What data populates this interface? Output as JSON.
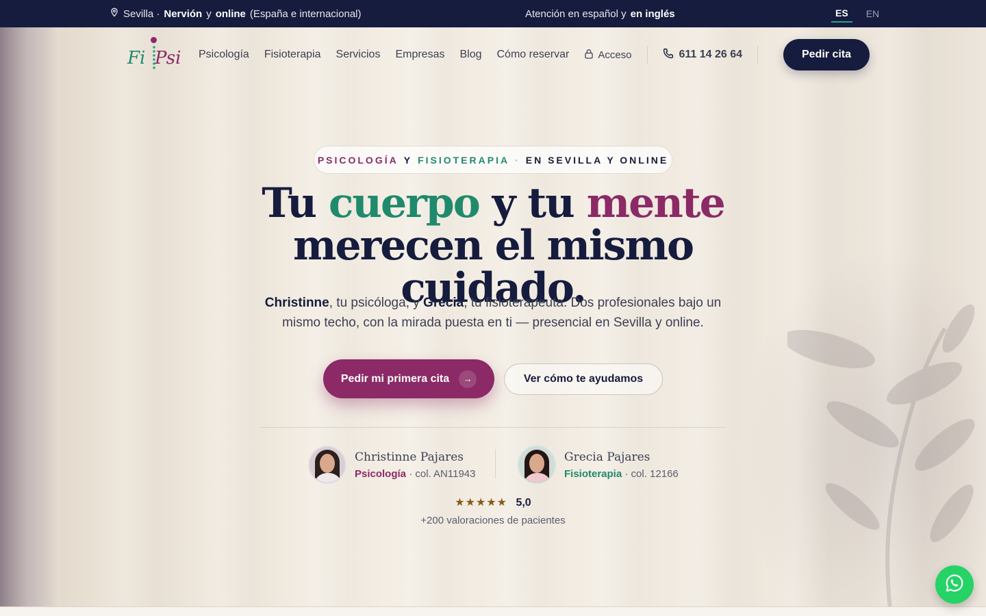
{
  "topbar": {
    "location_city": "Sevilla ·",
    "location_area": "Nervión",
    "location_y": "y",
    "location_online": "online",
    "location_scope": "(España e internacional)",
    "attention": "Atención en español y",
    "attention_english": "en inglés",
    "languages": [
      {
        "code": "ES",
        "active": true
      },
      {
        "code": "EN",
        "active": false
      }
    ]
  },
  "logo": {
    "fi": "Fi",
    "psi": "Psi"
  },
  "nav": {
    "items": [
      "Psicología",
      "Fisioterapia",
      "Servicios",
      "Empresas",
      "Blog",
      "Cómo reservar"
    ],
    "access": "Acceso",
    "phone": "611 14 26 64",
    "cta": "Pedir cita"
  },
  "hero": {
    "pill": {
      "psicologia": "PSICOLOGÍA",
      "y": "Y",
      "fisioterapia": "FISIOTERAPIA",
      "dot": "·",
      "location": "EN SEVILLA Y ONLINE"
    },
    "headline": {
      "tu1": "Tu",
      "cuerpo": "cuerpo",
      "ytu": "y tu",
      "mente": "mente",
      "line2": "merecen el mismo cuidado."
    },
    "lead": {
      "name1": "Christinne",
      "text1": ", tu psicóloga, y",
      "name2": "Grecia",
      "text2": ", tu fisioterapeuta. Dos profesionales bajo un mismo techo, con la mirada puesta en ti — presencial en Sevilla y online."
    },
    "cta_primary": "Pedir mi primera cita",
    "cta_primary_arrow": "→",
    "cta_secondary": "Ver cómo te ayudamos"
  },
  "people": [
    {
      "name": "Christinne Pajares",
      "role": "Psicología",
      "college": "· col. AN11943"
    },
    {
      "name": "Grecia Pajares",
      "role": "Fisioterapia",
      "college": "· col. 12166"
    }
  ],
  "rating": {
    "stars": "★★★★★",
    "score": "5,0",
    "reviews": "+200 valoraciones de pacientes"
  },
  "colors": {
    "navy": "#161c3d",
    "purple": "#8b2a66",
    "green": "#1f8a6c",
    "whatsapp": "#25d366"
  }
}
